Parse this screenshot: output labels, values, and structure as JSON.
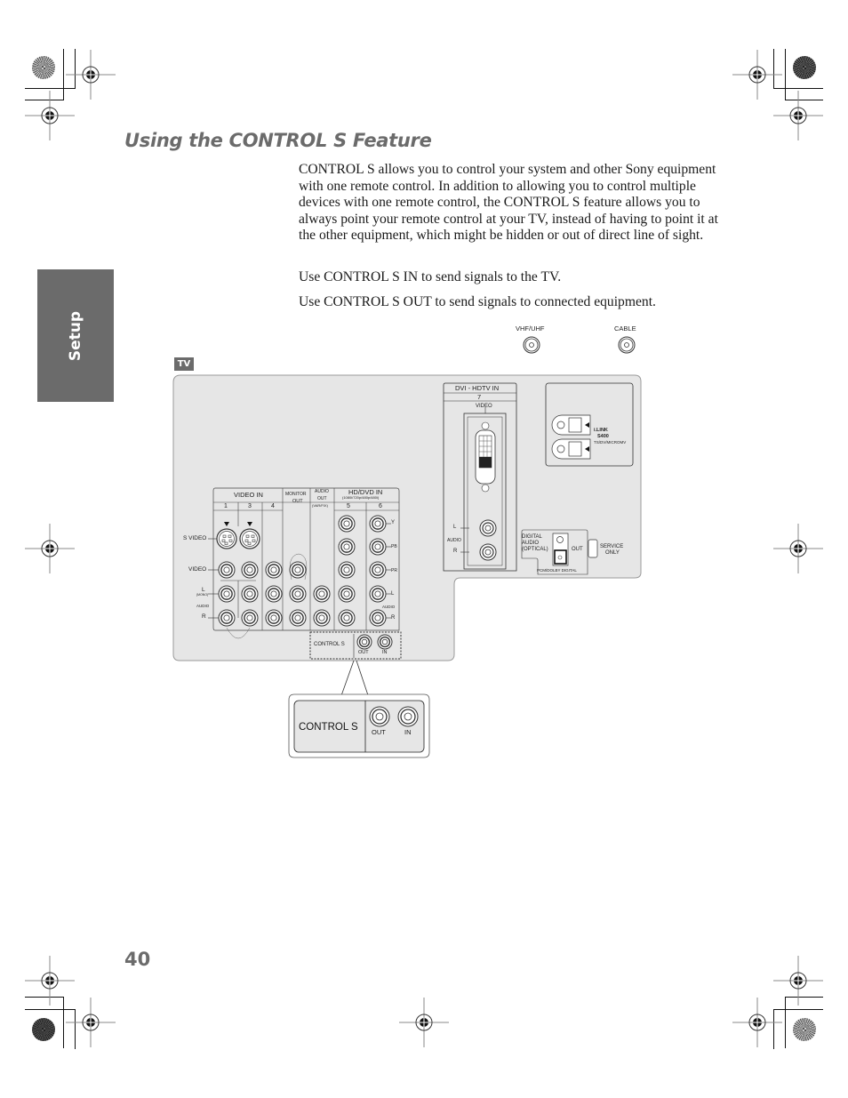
{
  "page": {
    "title": "Using the CONTROL S Feature",
    "side_tab": "Setup",
    "page_number": "40",
    "paragraphs": [
      "CONTROL S allows you to control your system and other Sony equipment with one remote control. In addition to allowing you to control multiple devices with one remote control, the CONTROL S feature allows you to always point your remote control at your TV, instead of having to point it at the other equipment, which might be hidden or out of direct line of sight.",
      "Use CONTROL S IN to send signals to the TV.",
      "Use CONTROL S OUT to send signals to connected equipment."
    ]
  },
  "diagram": {
    "tv_badge": "TV",
    "antenna": {
      "vhf_uhf": "VHF/UHF",
      "cable": "CABLE"
    },
    "dvi": {
      "title": "DVI - HDTV  IN",
      "number": "7",
      "video": "VIDEO",
      "audio": "AUDIO",
      "l": "L",
      "r": "R"
    },
    "ilink": {
      "line1": "i.LINK",
      "line2": "S400",
      "line3": "TS/DV/MICROMV"
    },
    "digital_audio": {
      "label1": "DIGITAL",
      "label2": "AUDIO",
      "label3": "(OPTICAL)",
      "out": "OUT",
      "format": "PCM/DOLBY DIGITAL"
    },
    "service": {
      "line1": "SERVICE",
      "line2": "ONLY"
    },
    "jack_panel": {
      "video_in": "VIDEO IN",
      "monitor_out": [
        "MONITOR",
        "OUT"
      ],
      "audio_out": [
        "AUDIO",
        "OUT",
        "(VAR/FIX)"
      ],
      "hd_dvd_in": "HD/DVD IN",
      "hd_dvd_sub": "(1080i/720p/480p/480i)",
      "columns": [
        "1",
        "3",
        "4",
        "5",
        "6"
      ],
      "row_labels": {
        "s_video": "S VIDEO",
        "video": "VIDEO",
        "l": "L",
        "mono": "(MONO)",
        "audio": "AUDIO",
        "r": "R"
      },
      "component_labels": [
        "Y",
        "PB",
        "PR",
        "L",
        "AUDIO",
        "R"
      ]
    },
    "control_s": {
      "label": "CONTROL S",
      "out": "OUT",
      "in": "IN"
    },
    "callout": {
      "label": "CONTROL S",
      "out": "OUT",
      "in": "IN"
    }
  }
}
